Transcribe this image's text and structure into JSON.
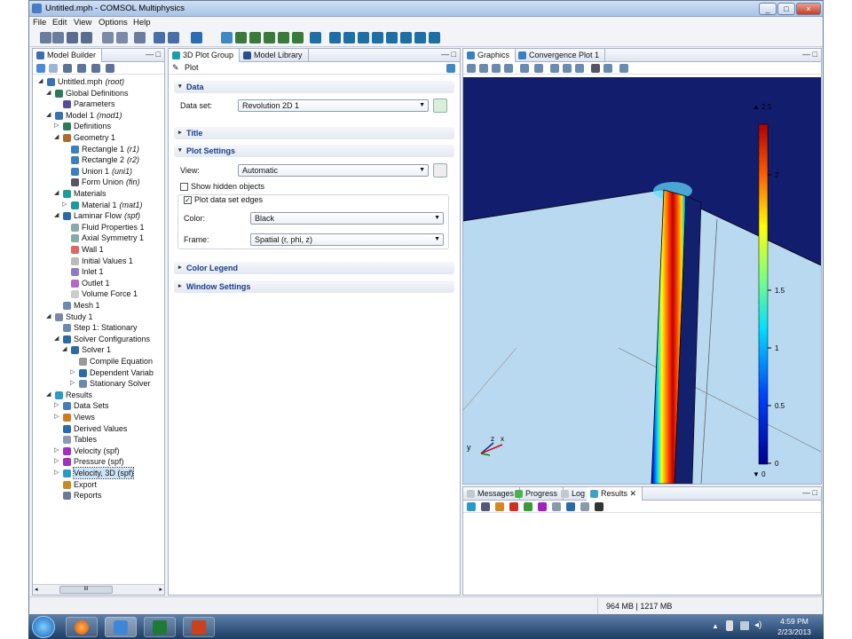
{
  "window": {
    "title": "Untitled.mph - COMSOL Multiphysics",
    "buttons": [
      "_",
      "□",
      "×"
    ]
  },
  "menu": [
    "File",
    "Edit",
    "View",
    "Options",
    "Help"
  ],
  "toolbar_icons": [
    "new-icon",
    "open-icon",
    "save-icon",
    "print-icon",
    "undo-icon",
    "redo-icon",
    "copy-icon",
    "help-icon",
    "context-help-icon",
    "sweep-icon",
    "select-icon",
    "line-icon",
    "arrow-icon",
    "bezier-icon",
    "polygon-icon",
    "shape-icon",
    "square-icon",
    "cube-icon",
    "cylinder-icon",
    "sphere-icon",
    "cone-icon",
    "torus-icon",
    "ellipsoid-icon",
    "helix-icon",
    "grid-icon"
  ],
  "model_builder": {
    "tab": "Model Builder",
    "tree": [
      {
        "depth": 0,
        "label": "Untitled.mph",
        "tag": "(root)",
        "exp": "open",
        "icon": "model-icon"
      },
      {
        "depth": 1,
        "label": "Global Definitions",
        "exp": "open",
        "icon": "global-definitions-icon"
      },
      {
        "depth": 2,
        "label": "Parameters",
        "icon": "parameters-icon"
      },
      {
        "depth": 1,
        "label": "Model 1",
        "tag": "(mod1)",
        "exp": "open",
        "icon": "model-icon"
      },
      {
        "depth": 2,
        "label": "Definitions",
        "exp": "closed",
        "icon": "definitions-icon"
      },
      {
        "depth": 2,
        "label": "Geometry 1",
        "exp": "open",
        "icon": "geometry-icon"
      },
      {
        "depth": 3,
        "label": "Rectangle 1",
        "tag": "(r1)",
        "icon": "rectangle-icon"
      },
      {
        "depth": 3,
        "label": "Rectangle 2",
        "tag": "(r2)",
        "icon": "rectangle-icon"
      },
      {
        "depth": 3,
        "label": "Union 1",
        "tag": "(uni1)",
        "icon": "union-icon"
      },
      {
        "depth": 3,
        "label": "Form Union",
        "tag": "(fin)",
        "icon": "form-union-icon"
      },
      {
        "depth": 2,
        "label": "Materials",
        "exp": "open",
        "icon": "materials-icon"
      },
      {
        "depth": 3,
        "label": "Material 1",
        "tag": "(mat1)",
        "exp": "closed",
        "icon": "material-icon"
      },
      {
        "depth": 2,
        "label": "Laminar Flow",
        "tag": "(spf)",
        "exp": "open",
        "icon": "laminar-flow-icon"
      },
      {
        "depth": 3,
        "label": "Fluid Properties 1",
        "icon": "fluid-properties-icon"
      },
      {
        "depth": 3,
        "label": "Axial Symmetry 1",
        "icon": "axial-symmetry-icon"
      },
      {
        "depth": 3,
        "label": "Wall 1",
        "icon": "wall-icon"
      },
      {
        "depth": 3,
        "label": "Initial Values 1",
        "icon": "initial-values-icon"
      },
      {
        "depth": 3,
        "label": "Inlet 1",
        "icon": "inlet-icon"
      },
      {
        "depth": 3,
        "label": "Outlet 1",
        "icon": "outlet-icon"
      },
      {
        "depth": 3,
        "label": "Volume Force 1",
        "icon": "volume-force-icon"
      },
      {
        "depth": 2,
        "label": "Mesh 1",
        "icon": "mesh-icon"
      },
      {
        "depth": 1,
        "label": "Study 1",
        "exp": "open",
        "icon": "study-icon"
      },
      {
        "depth": 2,
        "label": "Step 1: Stationary",
        "icon": "step-icon"
      },
      {
        "depth": 2,
        "label": "Solver Configurations",
        "exp": "open",
        "icon": "solver-configurations-icon"
      },
      {
        "depth": 3,
        "label": "Solver 1",
        "exp": "open",
        "icon": "solver-icon"
      },
      {
        "depth": 4,
        "label": "Compile Equation",
        "icon": "compile-equations-icon"
      },
      {
        "depth": 4,
        "label": "Dependent Variab",
        "exp": "closed",
        "icon": "dependent-variables-icon"
      },
      {
        "depth": 4,
        "label": "Stationary Solver",
        "exp": "closed",
        "icon": "stationary-solver-icon"
      },
      {
        "depth": 1,
        "label": "Results",
        "exp": "open",
        "icon": "results-icon"
      },
      {
        "depth": 2,
        "label": "Data Sets",
        "exp": "closed",
        "icon": "data-sets-icon"
      },
      {
        "depth": 2,
        "label": "Views",
        "exp": "closed",
        "icon": "views-icon"
      },
      {
        "depth": 2,
        "label": "Derived Values",
        "icon": "derived-values-icon"
      },
      {
        "depth": 2,
        "label": "Tables",
        "icon": "tables-icon"
      },
      {
        "depth": 2,
        "label": "Velocity (spf)",
        "exp": "closed",
        "icon": "plot-group-icon"
      },
      {
        "depth": 2,
        "label": "Pressure (spf)",
        "exp": "closed",
        "icon": "plot-group-icon"
      },
      {
        "depth": 2,
        "label": "Velocity, 3D (spf)",
        "exp": "closed",
        "icon": "plot-group-3d-icon",
        "selected": true
      },
      {
        "depth": 2,
        "label": "Export",
        "icon": "export-icon"
      },
      {
        "depth": 2,
        "label": "Reports",
        "icon": "reports-icon"
      }
    ],
    "scroll_label": "III"
  },
  "settings": {
    "tabs": [
      "3D Plot Group",
      "Model Library"
    ],
    "toolbar_title": "Plot",
    "sections": {
      "data": "Data",
      "title": "Title",
      "plot_settings": "Plot Settings",
      "color_legend": "Color Legend",
      "window_settings": "Window Settings"
    },
    "data_set_label": "Data set:",
    "data_set_value": "Revolution 2D 1",
    "view_label": "View:",
    "view_value": "Automatic",
    "show_hidden_label": "Show hidden objects",
    "show_hidden_checked": false,
    "plot_edges_label": "Plot data set edges",
    "plot_edges_checked": true,
    "color_label": "Color:",
    "color_value": "Black",
    "frame_label": "Frame:",
    "frame_value": "Spatial  (r, phi, z)"
  },
  "graphics": {
    "tabs": [
      "Graphics",
      "Convergence Plot 1"
    ],
    "toolbar_icons": [
      "zoom-in-icon",
      "zoom-out-icon",
      "zoom-box-icon",
      "zoom-extents-icon",
      "go-to-view-icon",
      "views-dropdown-icon",
      "view-xy-icon",
      "view-yz-icon",
      "view-zx-icon",
      "select-icon",
      "deselect-icon",
      "screenshot-icon"
    ],
    "legend_ticks": [
      "2",
      "1.5",
      "1",
      "0.5",
      "0"
    ],
    "legend_max_label": "▲ 2.5",
    "legend_min_label": "▼ 0",
    "axis_labels": [
      "z",
      "y",
      "x"
    ]
  },
  "messages": {
    "tabs": [
      "Messages",
      "Progress",
      "Log",
      "Results"
    ],
    "toolbar_icons": [
      "table-icon",
      "numeric-format-icon",
      "clear-icon",
      "delete-icon",
      "plot-icon",
      "color-icon",
      "copy-icon",
      "export-icon",
      "grid-icon",
      "dropdown-icon"
    ]
  },
  "status": {
    "memory": "964 MB | 1217 MB"
  },
  "taskbar": {
    "time": "4:59 PM",
    "date": "2/23/2013",
    "apps": [
      "start-orb-icon",
      "firefox-icon",
      "comsol-icon",
      "excel-icon",
      "powerpoint-icon"
    ]
  },
  "colors": {
    "accent": "#1a3d8a",
    "selection": "#cde3f7",
    "domain_dark": "#131d6e",
    "domain_light": "#b9d9f1"
  }
}
